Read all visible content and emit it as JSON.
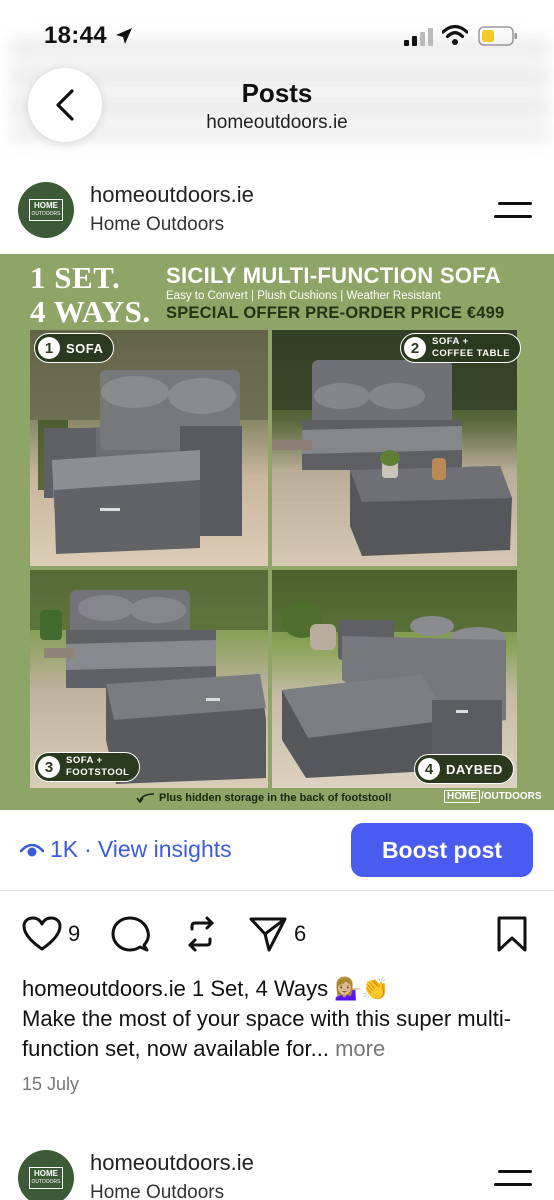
{
  "status_bar": {
    "time": "18:44"
  },
  "header": {
    "title": "Posts",
    "subtitle": "homeoutdoors.ie"
  },
  "post": {
    "account_name": "homeoutdoors.ie",
    "account_subtitle": "Home Outdoors",
    "avatar_logo": {
      "line1": "HOME",
      "line2": "OUTDOORS"
    },
    "promo": {
      "line1": "1 SET.",
      "line2": "4 WAYS.",
      "headline": "SICILY MULTI-FUNCTION SOFA",
      "features": "Easy to Convert | Plush Cushions | Weather Resistant",
      "offer": "SPECIAL OFFER PRE-ORDER PRICE €499",
      "panels": [
        {
          "num": "1",
          "label": "SOFA"
        },
        {
          "num": "2",
          "label_line1": "SOFA +",
          "label_line2": "COFFEE TABLE"
        },
        {
          "num": "3",
          "label_line1": "SOFA +",
          "label_line2": "FOOTSTOOL"
        },
        {
          "num": "4",
          "label": "DAYBED"
        }
      ],
      "footnote": "Plus hidden storage in the back of footstool!",
      "brand_box": "HOME",
      "brand_rest": "OUTDOORS"
    },
    "insights": {
      "views": "1K",
      "separator": "·",
      "link": "View insights"
    },
    "boost_label": "Boost post",
    "actions": {
      "likes": "9",
      "shares": "6"
    },
    "caption": {
      "user": "homeoutdoors.ie",
      "text_first": "1 Set, 4 Ways 💁🏼‍♀️👏",
      "body": "Make the most of your space with this super multi-function set, now available for...",
      "more": "more"
    },
    "date": "15 July"
  },
  "next_post": {
    "account_name": "homeoutdoors.ie",
    "account_subtitle": "Home Outdoors"
  },
  "colors": {
    "accent": "#4a5cf0",
    "link": "#3b5bdb",
    "promo_bg": "#8fa467",
    "badge": "#2b3a1f",
    "avatar": "#3c5a36"
  }
}
